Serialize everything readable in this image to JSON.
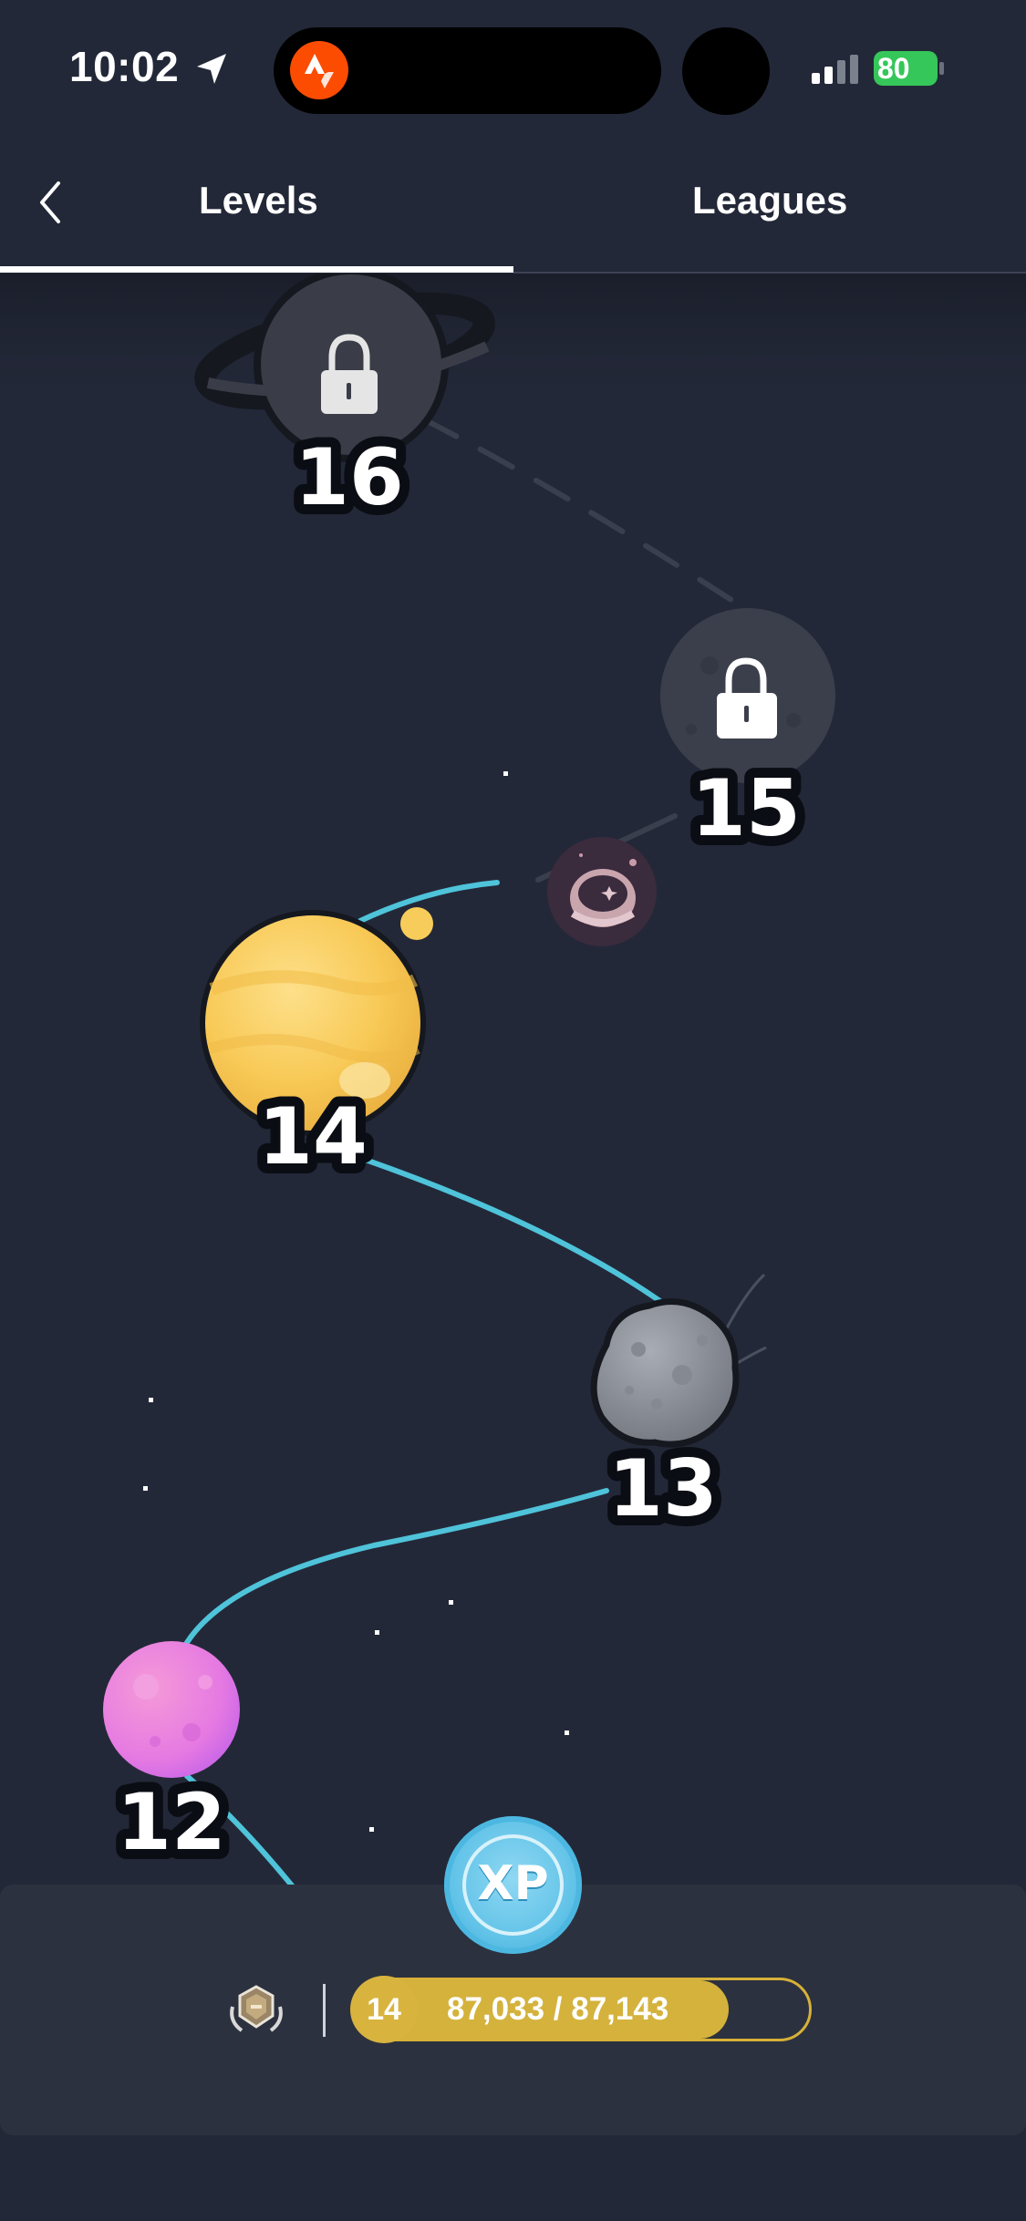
{
  "status_bar": {
    "time": "10:02",
    "battery": "80",
    "icons": [
      "location-arrow-icon",
      "strava-icon",
      "signal-icon",
      "battery-charging-icon"
    ]
  },
  "tabs": {
    "back_icon": "chevron-left-icon",
    "items": [
      {
        "label": "Levels",
        "selected": true
      },
      {
        "label": "Leagues",
        "selected": false
      }
    ]
  },
  "map": {
    "levels": [
      {
        "number": "16",
        "state": "locked",
        "planet": "ringed-planet"
      },
      {
        "number": "15",
        "state": "locked",
        "planet": "moon"
      },
      {
        "number": "14",
        "state": "current",
        "planet": "gas-giant"
      },
      {
        "number": "13",
        "state": "completed",
        "planet": "asteroid"
      },
      {
        "number": "12",
        "state": "completed",
        "planet": "pink-planet"
      }
    ],
    "marker": "astronaut-helmet-icon",
    "colors": {
      "path": "#4fc3d9",
      "gas_giant": "#f8cc5a",
      "pink_planet": "#e27ae6",
      "asteroid": "#8b8f99"
    }
  },
  "progress": {
    "badge": "XP",
    "league_icon": "league-badge-icon",
    "level": "14",
    "text": "87,033 / 87,143",
    "current": 87033,
    "target": 87143,
    "bar_color": "#d4b23c"
  }
}
